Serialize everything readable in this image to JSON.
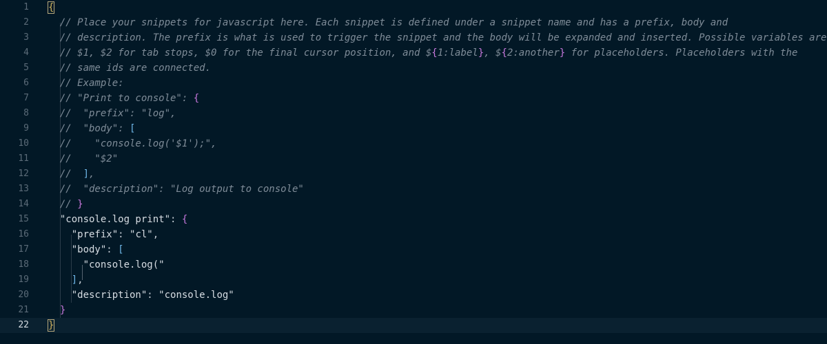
{
  "editor": {
    "lines": [
      {
        "num": "1",
        "segments": [
          {
            "t": "{",
            "c": "br1",
            "o": true
          }
        ]
      },
      {
        "num": "2",
        "segments": [
          {
            "t": "  ",
            "c": "ws"
          },
          {
            "t": "// Place your snippets for javascript here. Each snippet is defined under a snippet name and has a prefix, body and",
            "c": "cm"
          }
        ]
      },
      {
        "num": "3",
        "segments": [
          {
            "t": "  ",
            "c": "ws"
          },
          {
            "t": "// description. The prefix is what is used to trigger the snippet and the body will be expanded and inserted. Possible variables are:",
            "c": "cm"
          }
        ]
      },
      {
        "num": "4",
        "segments": [
          {
            "t": "  ",
            "c": "ws"
          },
          {
            "t": "// $1, $2 for tab stops, $0 for the final cursor position, and $",
            "c": "cm"
          },
          {
            "t": "{",
            "c": "br2"
          },
          {
            "t": "1:label",
            "c": "cm"
          },
          {
            "t": "}",
            "c": "br2"
          },
          {
            "t": ", $",
            "c": "cm"
          },
          {
            "t": "{",
            "c": "br2"
          },
          {
            "t": "2:another",
            "c": "cm"
          },
          {
            "t": "}",
            "c": "br2"
          },
          {
            "t": " for placeholders. Placeholders with the",
            "c": "cm"
          }
        ]
      },
      {
        "num": "5",
        "segments": [
          {
            "t": "  ",
            "c": "ws"
          },
          {
            "t": "// same ids are connected.",
            "c": "cm"
          }
        ]
      },
      {
        "num": "6",
        "segments": [
          {
            "t": "  ",
            "c": "ws"
          },
          {
            "t": "// Example:",
            "c": "cm"
          }
        ]
      },
      {
        "num": "7",
        "segments": [
          {
            "t": "  ",
            "c": "ws"
          },
          {
            "t": "// \"Print to console\": ",
            "c": "cm"
          },
          {
            "t": "{",
            "c": "br2"
          }
        ]
      },
      {
        "num": "8",
        "segments": [
          {
            "t": "  ",
            "c": "ws"
          },
          {
            "t": "//  \"prefix\": \"log\",",
            "c": "cm"
          }
        ]
      },
      {
        "num": "9",
        "segments": [
          {
            "t": "  ",
            "c": "ws"
          },
          {
            "t": "//  \"body\": ",
            "c": "cm"
          },
          {
            "t": "[",
            "c": "br3"
          }
        ]
      },
      {
        "num": "10",
        "segments": [
          {
            "t": "  ",
            "c": "ws"
          },
          {
            "t": "//    \"console.log('$1');\",",
            "c": "cm"
          }
        ]
      },
      {
        "num": "11",
        "segments": [
          {
            "t": "  ",
            "c": "ws"
          },
          {
            "t": "//    \"$2\"",
            "c": "cm"
          }
        ]
      },
      {
        "num": "12",
        "segments": [
          {
            "t": "  ",
            "c": "ws"
          },
          {
            "t": "//  ",
            "c": "cm"
          },
          {
            "t": "]",
            "c": "br3"
          },
          {
            "t": ",",
            "c": "cm"
          }
        ]
      },
      {
        "num": "13",
        "segments": [
          {
            "t": "  ",
            "c": "ws"
          },
          {
            "t": "//  \"description\": \"Log output to console\"",
            "c": "cm"
          }
        ]
      },
      {
        "num": "14",
        "segments": [
          {
            "t": "  ",
            "c": "ws"
          },
          {
            "t": "// ",
            "c": "cm"
          },
          {
            "t": "}",
            "c": "br2"
          }
        ]
      },
      {
        "num": "15",
        "segments": [
          {
            "t": "  ",
            "c": "ws"
          },
          {
            "t": "\"console.log print\"",
            "c": "str"
          },
          {
            "t": ": ",
            "c": "pun"
          },
          {
            "t": "{",
            "c": "br2"
          }
        ]
      },
      {
        "num": "16",
        "segments": [
          {
            "t": "    ",
            "c": "ws"
          },
          {
            "t": "\"prefix\"",
            "c": "str"
          },
          {
            "t": ": ",
            "c": "pun"
          },
          {
            "t": "\"cl\"",
            "c": "str"
          },
          {
            "t": ",",
            "c": "pun"
          }
        ]
      },
      {
        "num": "17",
        "segments": [
          {
            "t": "    ",
            "c": "ws"
          },
          {
            "t": "\"body\"",
            "c": "str"
          },
          {
            "t": ": ",
            "c": "pun"
          },
          {
            "t": "[",
            "c": "br3"
          }
        ]
      },
      {
        "num": "18",
        "segments": [
          {
            "t": "      ",
            "c": "ws"
          },
          {
            "t": "\"console.log(\"",
            "c": "str"
          }
        ]
      },
      {
        "num": "19",
        "segments": [
          {
            "t": "    ",
            "c": "ws"
          },
          {
            "t": "]",
            "c": "br3"
          },
          {
            "t": ",",
            "c": "pun"
          }
        ]
      },
      {
        "num": "20",
        "segments": [
          {
            "t": "    ",
            "c": "ws"
          },
          {
            "t": "\"description\"",
            "c": "str"
          },
          {
            "t": ": ",
            "c": "pun"
          },
          {
            "t": "\"console.log\"",
            "c": "str"
          }
        ]
      },
      {
        "num": "21",
        "segments": [
          {
            "t": "  ",
            "c": "ws"
          },
          {
            "t": "}",
            "c": "br2"
          }
        ]
      },
      {
        "num": "22",
        "segments": [
          {
            "t": "}",
            "c": "br1",
            "o": true
          }
        ],
        "current": true
      }
    ]
  },
  "theme": {
    "background": "#021826",
    "current_line": "#0a2130",
    "comment": "#7f8c98",
    "string": "#d7dde3",
    "bracket_level1": "#d1b35d",
    "bracket_level2": "#c778dd",
    "bracket_level3": "#6fb7e8"
  }
}
